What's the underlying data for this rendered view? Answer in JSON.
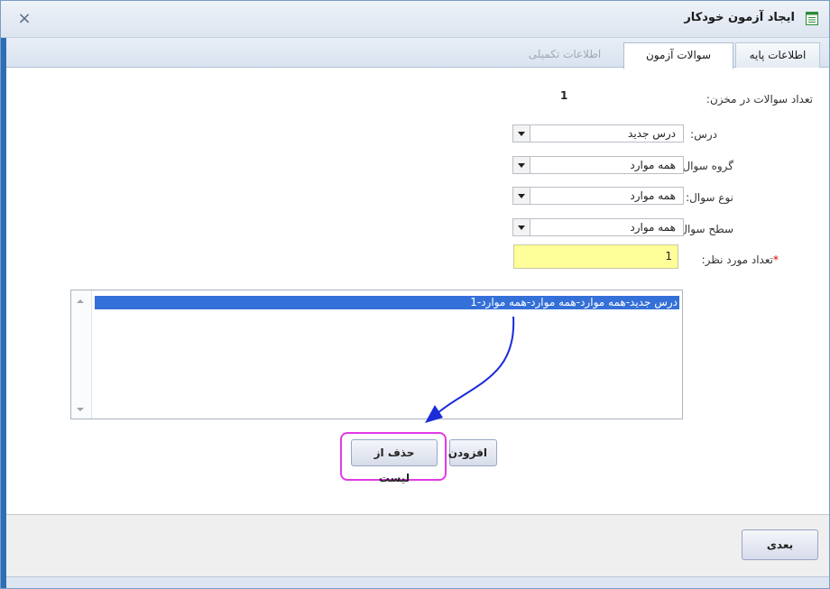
{
  "window": {
    "title": "ایجاد آزمون خودکار",
    "close_glyph": "×",
    "title_icon": "form-icon"
  },
  "tabs": [
    {
      "label": "اطلاعات پایه",
      "state": "normal"
    },
    {
      "label": "سوالات آزمون",
      "state": "active"
    },
    {
      "label": "اطلاعات تکمیلی",
      "state": "disabled"
    }
  ],
  "form": {
    "question_count_label": "تعداد سوالات در مخزن:",
    "question_count_value": "1",
    "lesson": {
      "label": "درس:",
      "value": "درس جدید"
    },
    "question_group": {
      "label": "گروه سوال:",
      "value": "همه موارد"
    },
    "question_type": {
      "label": "نوع سوال:",
      "value": "همه موارد"
    },
    "question_level": {
      "label": "سطح سوال:",
      "value": "همه موارد"
    },
    "desired_count": {
      "label": "تعداد مورد نظر:",
      "required_mark": "*",
      "value": "1"
    }
  },
  "listbox": {
    "items": [
      "درس جدید-همه موارد-همه موارد-همه موارد-1"
    ],
    "selected_index": 0
  },
  "buttons": {
    "add": "افزودن",
    "remove": "حذف از لیست",
    "next": "بعدی"
  },
  "annotations": {
    "arrow_color": "#1a2bd8",
    "highlight_color": "#e23ae6"
  },
  "colors": {
    "selection": "#3470d8",
    "input_highlight": "#ffff99",
    "required": "#d40000"
  }
}
